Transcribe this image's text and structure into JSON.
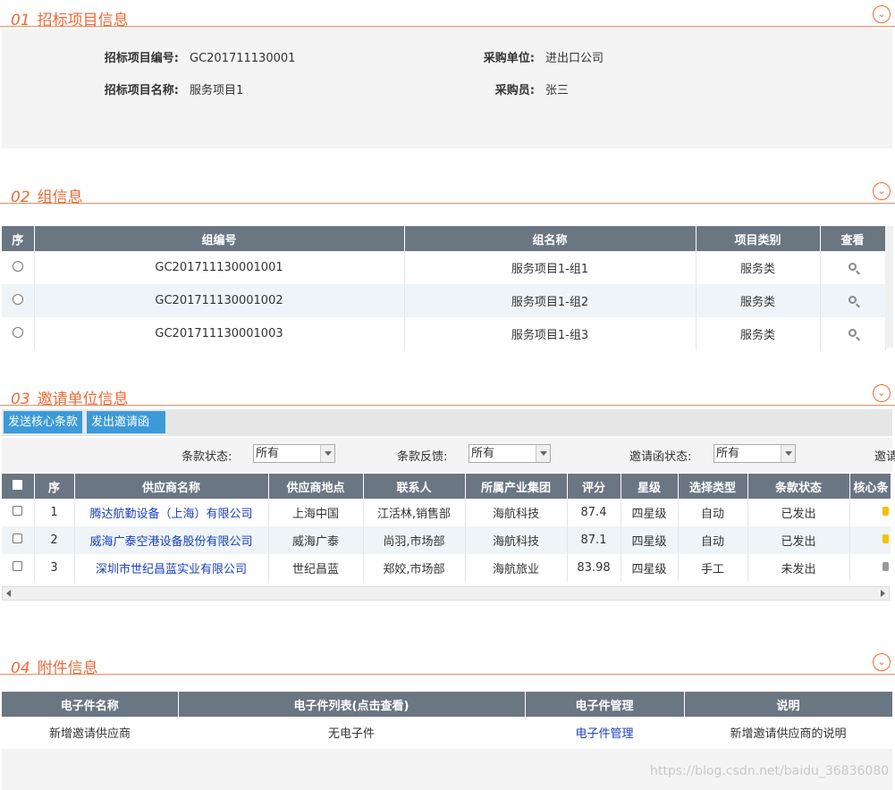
{
  "sections": {
    "s1": {
      "num": "01",
      "title": "招标项目信息"
    },
    "s2": {
      "num": "02",
      "title": "组信息"
    },
    "s3": {
      "num": "03",
      "title": "邀请单位信息"
    },
    "s4": {
      "num": "04",
      "title": "附件信息"
    }
  },
  "project_info": {
    "code_label": "招标项目编号:",
    "code_value": "GC201711130001",
    "unit_label": "采购单位:",
    "unit_value": "进出口公司",
    "name_label": "招标项目名称:",
    "name_value": "服务项目1",
    "buyer_label": "采购员:",
    "buyer_value": "张三"
  },
  "groups": {
    "headers": [
      "序",
      "组编号",
      "组名称",
      "项目类别",
      "查看"
    ],
    "rows": [
      {
        "code": "GC201711130001001",
        "name": "服务项目1-组1",
        "category": "服务类"
      },
      {
        "code": "GC201711130001002",
        "name": "服务项目1-组2",
        "category": "服务类"
      },
      {
        "code": "GC201711130001003",
        "name": "服务项目1-组3",
        "category": "服务类"
      }
    ]
  },
  "invite": {
    "buttons": {
      "send_terms": "发送核心条款",
      "send_invite": "发出邀请函"
    },
    "filters": {
      "terms_status_label": "条款状态:",
      "terms_status_value": "所有",
      "terms_feedback_label": "条款反馈:",
      "terms_feedback_value": "所有",
      "invite_status_label": "邀请函状态:",
      "invite_status_value": "所有",
      "cut_label": "邀请"
    },
    "headers": [
      "序",
      "供应商名称",
      "供应商地点",
      "联系人",
      "所属产业集团",
      "评分",
      "星级",
      "选择类型",
      "条款状态",
      "核心条"
    ],
    "rows": [
      {
        "seq": "1",
        "name": "腾达航勤设备（上海）有限公司",
        "location": "上海中国",
        "contact": "江活林,销售部",
        "group": "海航科技",
        "score": "87.4",
        "stars": "四星级",
        "select_type": "自动",
        "terms_status": "已发出",
        "core_color": "#f2c200"
      },
      {
        "seq": "2",
        "name": "威海广泰空港设备股份有限公司",
        "location": "威海广泰",
        "contact": "尚羽,市场部",
        "group": "海航科技",
        "score": "87.1",
        "stars": "四星级",
        "select_type": "自动",
        "terms_status": "已发出",
        "core_color": "#f2c200"
      },
      {
        "seq": "3",
        "name": "深圳市世纪昌蓝实业有限公司",
        "location": "世纪昌蓝",
        "contact": "郑姣,市场部",
        "group": "海航旅业",
        "score": "83.98",
        "stars": "四星级",
        "select_type": "手工",
        "terms_status": "未发出",
        "core_color": "#999999"
      }
    ]
  },
  "attachments": {
    "headers": [
      "电子件名称",
      "电子件列表(点击查看)",
      "电子件管理",
      "说明"
    ],
    "rows": [
      {
        "name": "新增邀请供应商",
        "list": "无电子件",
        "manage": "电子件管理",
        "desc": "新增邀请供应商的说明"
      }
    ]
  },
  "watermark": "https://blog.csdn.net/baidu_36836080",
  "colors": {
    "accent": "#ec6a35",
    "header_bg": "#6b7683",
    "button": "#3d9ad9",
    "link": "#1a3fbf"
  }
}
